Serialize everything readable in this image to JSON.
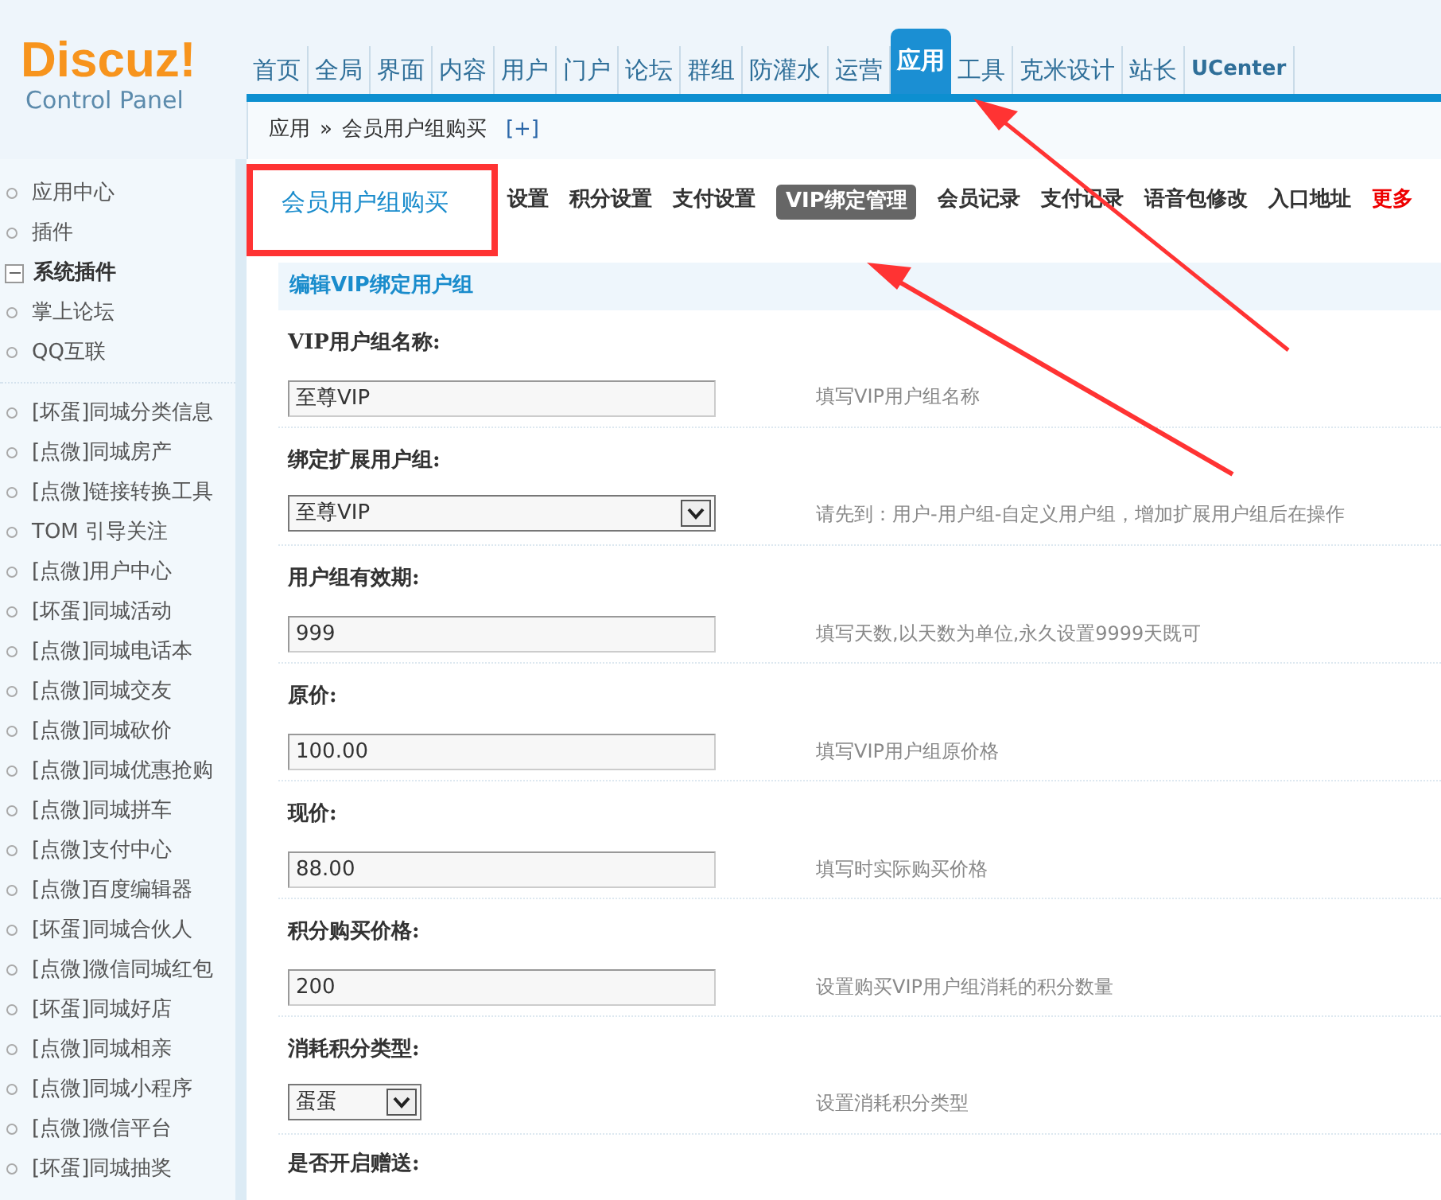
{
  "logo": {
    "title": "Discuz!",
    "subtitle": "Control Panel"
  },
  "nav": [
    {
      "label": "首页",
      "kind": "item",
      "selected": false
    },
    {
      "label": "全局",
      "kind": "item",
      "selected": false
    },
    {
      "label": "界面",
      "kind": "item",
      "selected": false
    },
    {
      "label": "内容",
      "kind": "item",
      "selected": false
    },
    {
      "label": "用户",
      "kind": "item",
      "selected": false
    },
    {
      "label": "门户",
      "kind": "item",
      "selected": false
    },
    {
      "label": "论坛",
      "kind": "item",
      "selected": false
    },
    {
      "label": "群组",
      "kind": "item",
      "selected": false
    },
    {
      "label": "防灌水",
      "kind": "item",
      "selected": false
    },
    {
      "label": "运营",
      "kind": "item",
      "selected": false
    },
    {
      "label": "应用",
      "kind": "item",
      "selected": true
    },
    {
      "label": "工具",
      "kind": "item",
      "selected": false
    },
    {
      "label": "克米设计",
      "kind": "item",
      "selected": false
    },
    {
      "label": "站长",
      "kind": "item",
      "selected": false
    },
    {
      "label": "UCenter",
      "kind": "brand",
      "selected": false
    }
  ],
  "breadcrumb": {
    "parts": [
      "应用",
      "»",
      "会员用户组购买"
    ],
    "add": "[+]"
  },
  "sidebar": {
    "sections": [
      {
        "items": [
          {
            "label": "应用中心",
            "kind": "item"
          },
          {
            "label": "插件",
            "kind": "item"
          },
          {
            "label": "系统插件",
            "kind": "group"
          },
          {
            "label": "掌上论坛",
            "kind": "item"
          },
          {
            "label": "QQ互联",
            "kind": "item"
          }
        ]
      },
      {
        "items": [
          {
            "label": "[坏蛋]同城分类信息",
            "kind": "item"
          },
          {
            "label": "[点微]同城房产",
            "kind": "item"
          },
          {
            "label": "[点微]链接转换工具",
            "kind": "item"
          },
          {
            "label": "TOM 引导关注",
            "kind": "item"
          },
          {
            "label": "[点微]用户中心",
            "kind": "item"
          },
          {
            "label": "[坏蛋]同城活动",
            "kind": "item"
          },
          {
            "label": "[点微]同城电话本",
            "kind": "item"
          },
          {
            "label": "[点微]同城交友",
            "kind": "item"
          },
          {
            "label": "[点微]同城砍价",
            "kind": "item"
          },
          {
            "label": "[点微]同城优惠抢购",
            "kind": "item"
          },
          {
            "label": "[点微]同城拼车",
            "kind": "item"
          },
          {
            "label": "[点微]支付中心",
            "kind": "item"
          },
          {
            "label": "[点微]百度编辑器",
            "kind": "item"
          },
          {
            "label": "[坏蛋]同城合伙人",
            "kind": "item"
          },
          {
            "label": "[点微]微信同城红包",
            "kind": "item"
          },
          {
            "label": "[坏蛋]同城好店",
            "kind": "item"
          },
          {
            "label": "[点微]同城相亲",
            "kind": "item"
          },
          {
            "label": "[点微]同城小程序",
            "kind": "item"
          },
          {
            "label": "[点微]微信平台",
            "kind": "item"
          },
          {
            "label": "[坏蛋]同城抽奖",
            "kind": "item"
          }
        ]
      }
    ]
  },
  "plugin_title": "会员用户组购买",
  "tabs": [
    {
      "label": "设置",
      "kind": "normal",
      "selected": false
    },
    {
      "label": "积分设置",
      "kind": "normal",
      "selected": false
    },
    {
      "label": "支付设置",
      "kind": "normal",
      "selected": false
    },
    {
      "label": "VIP绑定管理",
      "kind": "normal",
      "selected": true
    },
    {
      "label": "会员记录",
      "kind": "normal",
      "selected": false
    },
    {
      "label": "支付记录",
      "kind": "normal",
      "selected": false
    },
    {
      "label": "语音包修改",
      "kind": "normal",
      "selected": false
    },
    {
      "label": "入口地址",
      "kind": "normal",
      "selected": false
    },
    {
      "label": "更多",
      "kind": "highlight",
      "selected": false
    }
  ],
  "section_title": "编辑VIP绑定用户组",
  "form": [
    {
      "label": "VIP用户组名称:",
      "field": {
        "kind": "text",
        "value": "至尊VIP"
      },
      "hint": "填写VIP用户组名称"
    },
    {
      "label": "绑定扩展用户组:",
      "field": {
        "kind": "select",
        "value": "至尊VIP"
      },
      "hint": "请先到：用户-用户组-自定义用户组，增加扩展用户组后在操作"
    },
    {
      "label": "用户组有效期:",
      "field": {
        "kind": "text",
        "value": "999"
      },
      "hint": "填写天数,以天数为单位,永久设置9999天既可"
    },
    {
      "label": "原价:",
      "field": {
        "kind": "text",
        "value": "100.00"
      },
      "hint": "填写VIP用户组原价格"
    },
    {
      "label": "现价:",
      "field": {
        "kind": "text",
        "value": "88.00"
      },
      "hint": "填写时实际购买价格"
    },
    {
      "label": "积分购买价格:",
      "field": {
        "kind": "text",
        "value": "200"
      },
      "hint": "设置购买VIP用户组消耗的积分数量"
    },
    {
      "label": "消耗积分类型:",
      "field": {
        "kind": "shortselect",
        "value": "蛋蛋"
      },
      "hint": "设置消耗积分类型"
    },
    {
      "label": "是否开启赠送:"
    }
  ]
}
